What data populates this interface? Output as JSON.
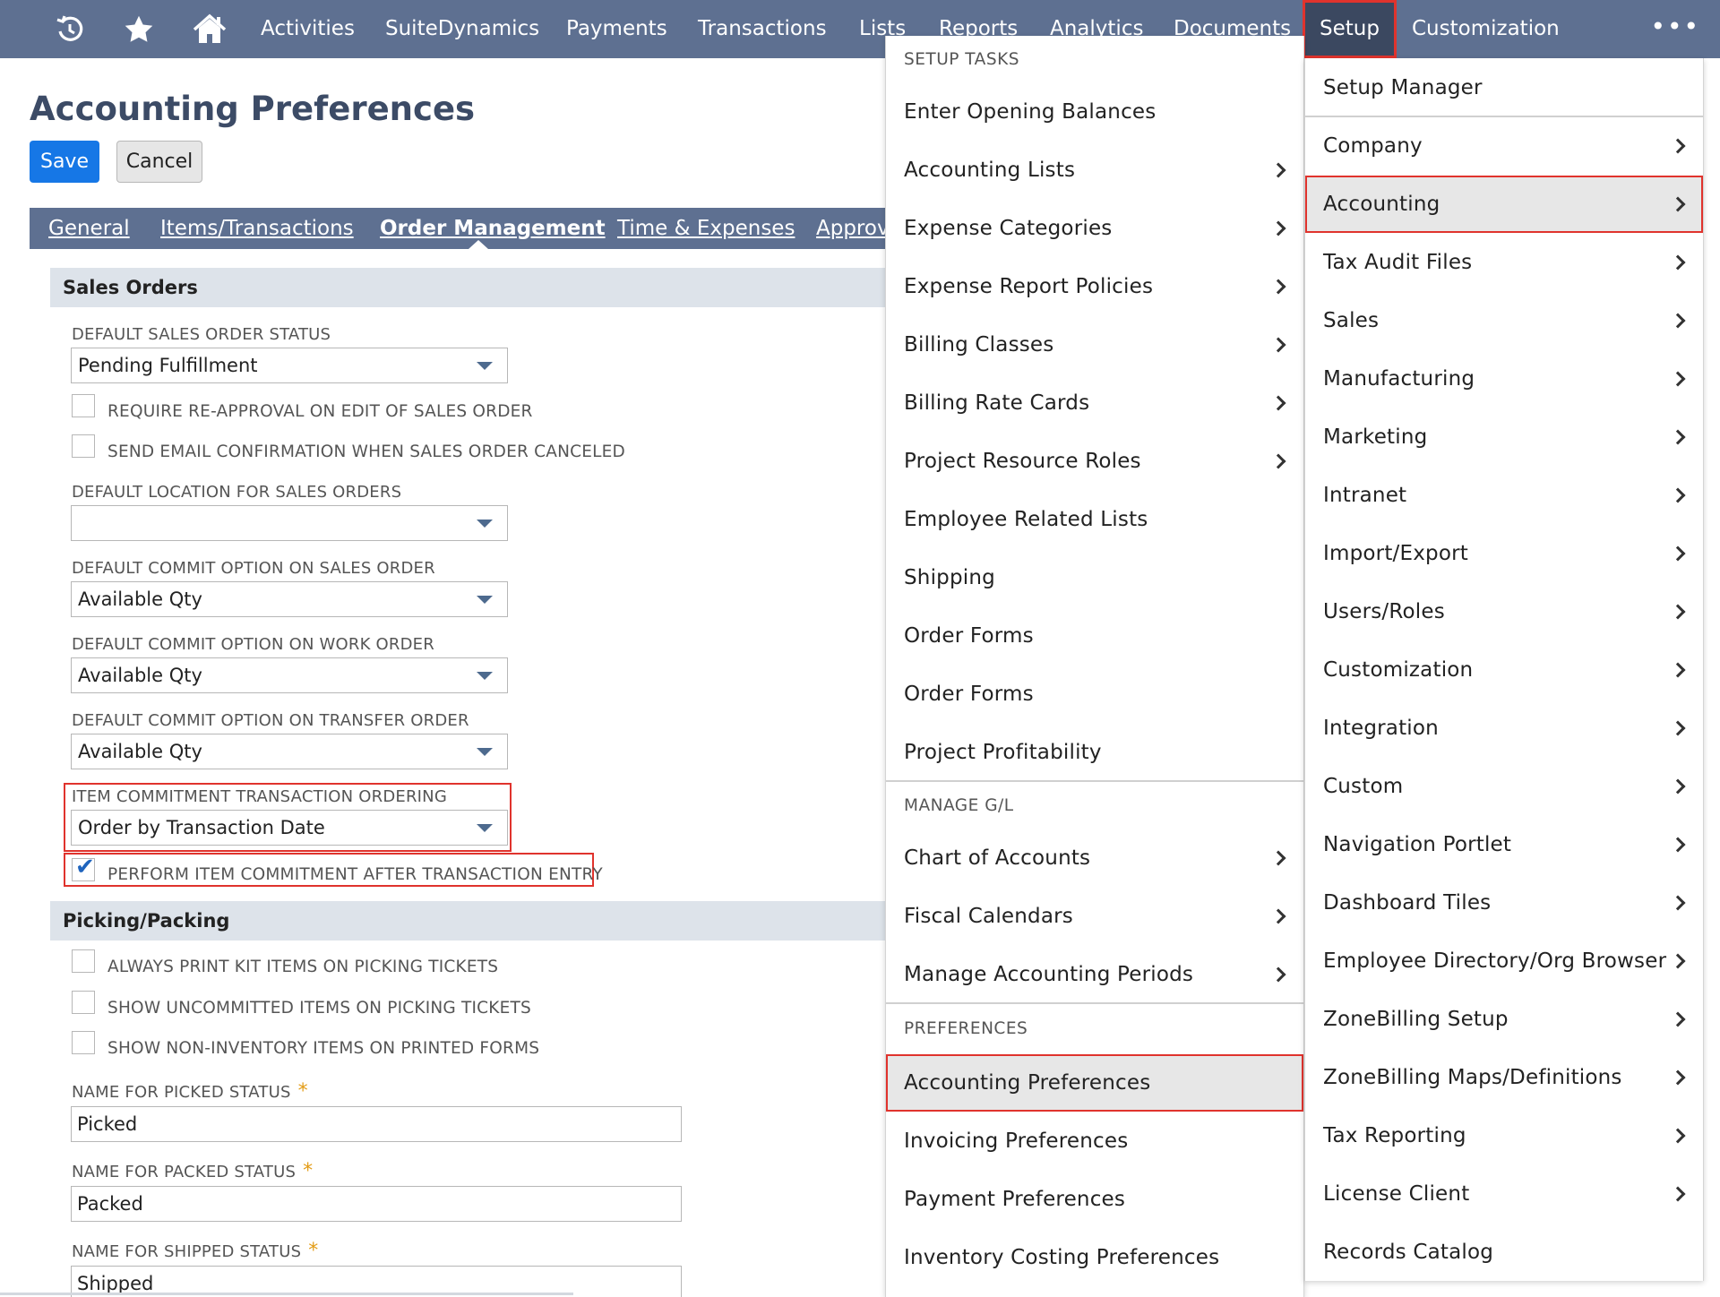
{
  "nav": {
    "items": [
      "Activities",
      "SuiteDynamics",
      "Payments",
      "Transactions",
      "Lists",
      "Reports",
      "Analytics",
      "Documents",
      "Setup",
      "Customization"
    ],
    "more": "•••",
    "icons": [
      "recent-history-icon",
      "star-icon",
      "home-icon"
    ]
  },
  "page": {
    "title": "Accounting Preferences",
    "save_label": "Save",
    "cancel_label": "Cancel",
    "tabs": [
      "General",
      "Items/Transactions",
      "Order Management",
      "Time & Expenses",
      "Approv"
    ],
    "active_tab": "Order Management"
  },
  "form": {
    "sales_orders": {
      "heading": "Sales Orders",
      "default_status_label": "DEFAULT SALES ORDER STATUS",
      "default_status_value": "Pending Fulfillment",
      "reapproval_label": "REQUIRE RE-APPROVAL ON EDIT OF SALES ORDER",
      "reapproval_checked": false,
      "email_confirm_label": "SEND EMAIL CONFIRMATION WHEN SALES ORDER CANCELED",
      "email_confirm_checked": false,
      "default_location_label": "DEFAULT LOCATION FOR SALES ORDERS",
      "default_location_value": "",
      "commit_sales_label": "DEFAULT COMMIT OPTION ON SALES ORDER",
      "commit_sales_value": "Available Qty",
      "commit_work_label": "DEFAULT COMMIT OPTION ON WORK ORDER",
      "commit_work_value": "Available Qty",
      "commit_transfer_label": "DEFAULT COMMIT OPTION ON TRANSFER ORDER",
      "commit_transfer_value": "Available Qty",
      "item_commit_order_label": "ITEM COMMITMENT TRANSACTION ORDERING",
      "item_commit_order_value": "Order by Transaction Date",
      "perform_commit_label": "PERFORM ITEM COMMITMENT AFTER TRANSACTION ENTRY",
      "perform_commit_checked": true
    },
    "picking": {
      "heading": "Picking/Packing",
      "kit_label": "ALWAYS PRINT KIT ITEMS ON PICKING TICKETS",
      "uncommitted_label": "SHOW UNCOMMITTED ITEMS ON PICKING TICKETS",
      "noninventory_label": "SHOW NON-INVENTORY ITEMS ON PRINTED FORMS",
      "picked_label": "NAME FOR PICKED STATUS",
      "picked_value": "Picked",
      "packed_label": "NAME FOR PACKED STATUS",
      "packed_value": "Packed",
      "shipped_label": "NAME FOR SHIPPED STATUS",
      "shipped_value": "Shipped",
      "required_mark": "*"
    }
  },
  "menu1": {
    "header_setup_tasks": "SETUP TASKS",
    "setup_tasks": [
      {
        "label": "Enter Opening Balances",
        "sub": false
      },
      {
        "label": "Accounting Lists",
        "sub": true
      },
      {
        "label": "Expense Categories",
        "sub": true
      },
      {
        "label": "Expense Report Policies",
        "sub": true
      },
      {
        "label": "Billing Classes",
        "sub": true
      },
      {
        "label": "Billing Rate Cards",
        "sub": true
      },
      {
        "label": "Project Resource Roles",
        "sub": true
      },
      {
        "label": "Employee Related Lists",
        "sub": false
      },
      {
        "label": "Shipping",
        "sub": false
      },
      {
        "label": "Order Forms",
        "sub": false
      },
      {
        "label": "Order Forms",
        "sub": false
      },
      {
        "label": "Project Profitability",
        "sub": false
      }
    ],
    "header_manage_gl": "MANAGE G/L",
    "manage_gl": [
      {
        "label": "Chart of Accounts",
        "sub": true
      },
      {
        "label": "Fiscal Calendars",
        "sub": true
      },
      {
        "label": "Manage Accounting Periods",
        "sub": true
      }
    ],
    "header_preferences": "PREFERENCES",
    "preferences": [
      {
        "label": "Accounting Preferences",
        "sub": false
      },
      {
        "label": "Invoicing Preferences",
        "sub": false
      },
      {
        "label": "Payment Preferences",
        "sub": false
      },
      {
        "label": "Inventory Costing Preferences",
        "sub": false
      }
    ]
  },
  "menu2": {
    "items": [
      {
        "label": "Setup Manager",
        "sub": false
      },
      {
        "label": "Company",
        "sub": true
      },
      {
        "label": "Accounting",
        "sub": true
      },
      {
        "label": "Tax Audit Files",
        "sub": true
      },
      {
        "label": "Sales",
        "sub": true
      },
      {
        "label": "Manufacturing",
        "sub": true
      },
      {
        "label": "Marketing",
        "sub": true
      },
      {
        "label": "Intranet",
        "sub": true
      },
      {
        "label": "Import/Export",
        "sub": true
      },
      {
        "label": "Users/Roles",
        "sub": true
      },
      {
        "label": "Customization",
        "sub": true
      },
      {
        "label": "Integration",
        "sub": true
      },
      {
        "label": "Custom",
        "sub": true
      },
      {
        "label": "Navigation Portlet",
        "sub": true
      },
      {
        "label": "Dashboard Tiles",
        "sub": true
      },
      {
        "label": "Employee Directory/Org Browser",
        "sub": true
      },
      {
        "label": "ZoneBilling Setup",
        "sub": true
      },
      {
        "label": "ZoneBilling Maps/Definitions",
        "sub": true
      },
      {
        "label": "Tax Reporting",
        "sub": true
      },
      {
        "label": "License Client",
        "sub": true
      },
      {
        "label": "Records Catalog",
        "sub": false
      }
    ]
  },
  "colors": {
    "nav_bg": "#5e7091",
    "nav_active_bg": "#3b4860",
    "highlight_red": "#e0332d",
    "save_blue": "#1677e6",
    "title_color": "#3c4b66"
  }
}
